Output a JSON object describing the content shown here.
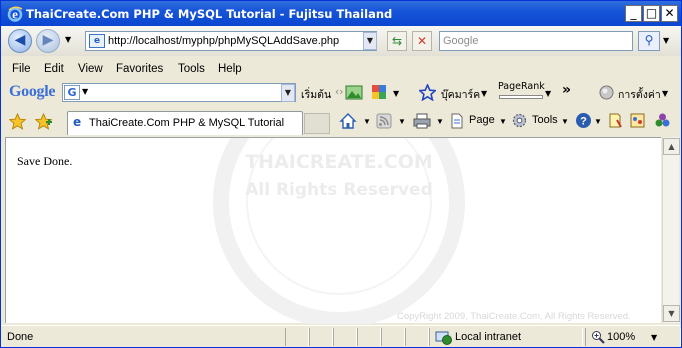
{
  "window": {
    "title": "ThaiCreate.Com PHP & MySQL Tutorial - Fujitsu Thailand",
    "icons": [
      "ie-logo-icon",
      "minimize-icon",
      "maximize-icon",
      "close-icon"
    ]
  },
  "nav": {
    "address": "http://localhost/myphp/phpMySQLAddSave.php",
    "search_placeholder": "Google"
  },
  "menu": {
    "items": [
      "File",
      "Edit",
      "View",
      "Favorites",
      "Tools",
      "Help"
    ]
  },
  "google_toolbar": {
    "logo": "Google",
    "search_label": "เริ่มต้น",
    "bookmarks_label": "บุ๊คมาร์ค",
    "pagerank_label": "PageRank",
    "settings_label": "การตั้งค่า",
    "more_label": "»"
  },
  "tabs": {
    "active_tab": "ThaiCreate.Com PHP & MySQL Tutorial"
  },
  "command_bar": {
    "page_label": "Page",
    "tools_label": "Tools"
  },
  "content": {
    "message": "Save Done.",
    "watermark_line1": "THAICREATE.COM",
    "watermark_line2": "All Rights Reserved",
    "copyright": "CopyRight 2009, ThaiCreate.Com, All Rights Reserved."
  },
  "status": {
    "text": "Done",
    "zone": "Local intranet",
    "zoom": "100%"
  },
  "colors": {
    "titlebar": "#0A46D0",
    "chrome": "#ECE9D8",
    "border": "#0831D9"
  }
}
